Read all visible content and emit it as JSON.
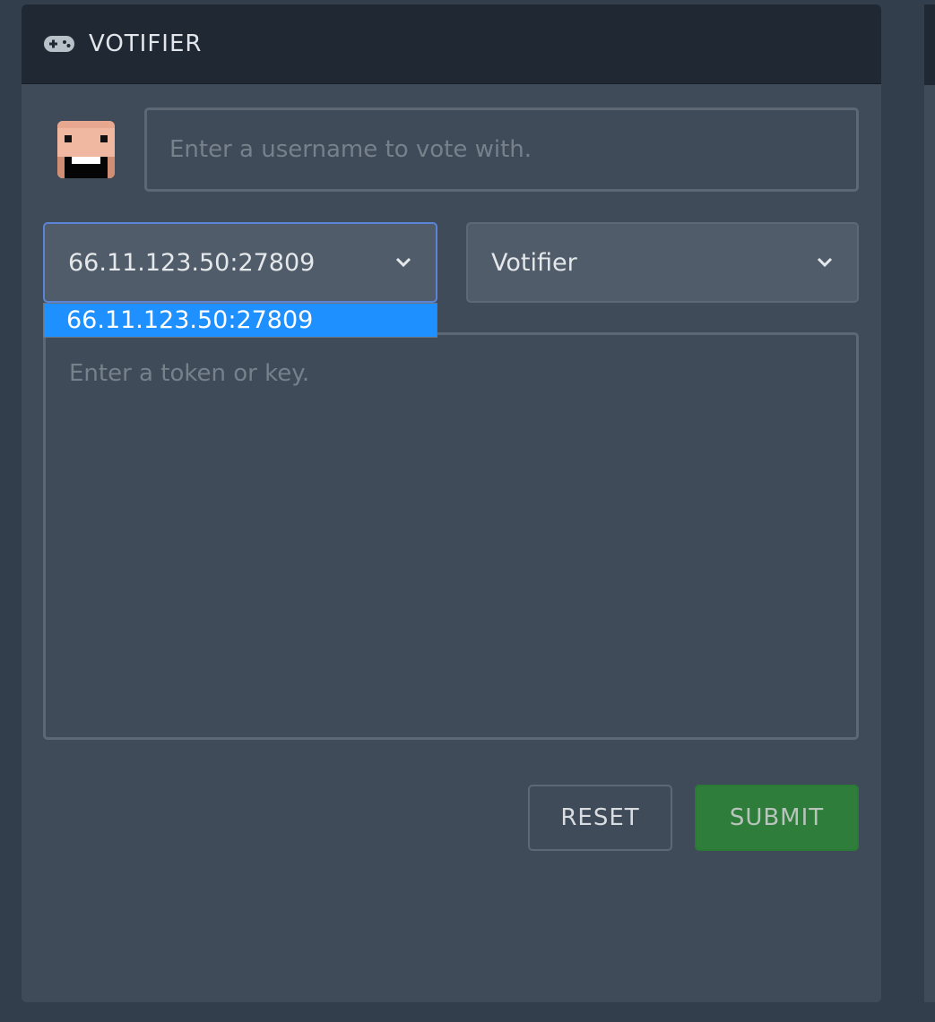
{
  "header": {
    "icon": "gamepad-icon",
    "title": "VOTIFIER"
  },
  "username": {
    "placeholder": "Enter a username to vote with.",
    "value": ""
  },
  "server_select": {
    "selected": "66.11.123.50:27809",
    "options": [
      "66.11.123.50:27809"
    ],
    "highlighted_option": "66.11.123.50:27809"
  },
  "type_select": {
    "selected": "Votifier"
  },
  "token": {
    "placeholder": "Enter a token or key.",
    "value": ""
  },
  "buttons": {
    "reset_label": "RESET",
    "submit_label": "SUBMIT"
  },
  "colors": {
    "page_bg": "#323e4b",
    "card_bg": "#3f4b58",
    "header_bg": "#202833",
    "highlight": "#1e90ff",
    "submit": "#2e7d3a"
  }
}
